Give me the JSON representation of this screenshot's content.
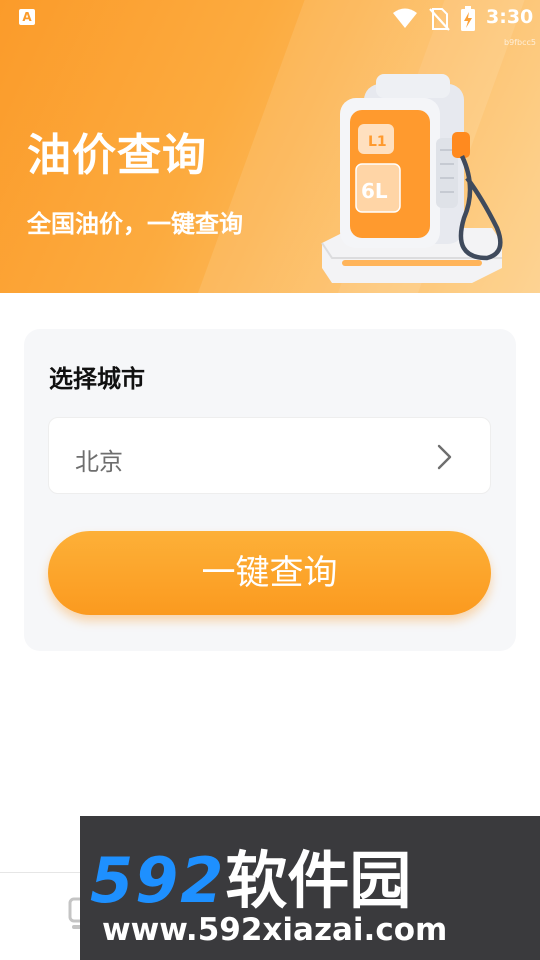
{
  "status_bar": {
    "app_badge": "A",
    "time": "3:30",
    "icons": [
      "wifi-icon",
      "no-sim-icon",
      "battery-charging-icon"
    ]
  },
  "header": {
    "tag": "b9fbcc5",
    "title": "油价查询",
    "subtitle": "全国油价，一键查询",
    "illustration": "fuel-pump-icon",
    "pump_display": "6L"
  },
  "card": {
    "label": "选择城市",
    "city_value": "北京",
    "city_chevron": "chevron-right-icon",
    "button_label": "一键查询"
  },
  "bottom_nav": {
    "partial_item_icon": "nav-icon"
  },
  "overlay": {
    "brand_number": "592",
    "brand_text": "软件园",
    "url": "www.592xiazai.com"
  },
  "colors": {
    "primary": "#fb9b2a",
    "button_gradient_top": "#fdb038",
    "button_gradient_bottom": "#fb9a1f",
    "card_background": "#f6f7f9",
    "overlay_background": "#3a3a3d",
    "brand_blue": "#1e90ff"
  }
}
